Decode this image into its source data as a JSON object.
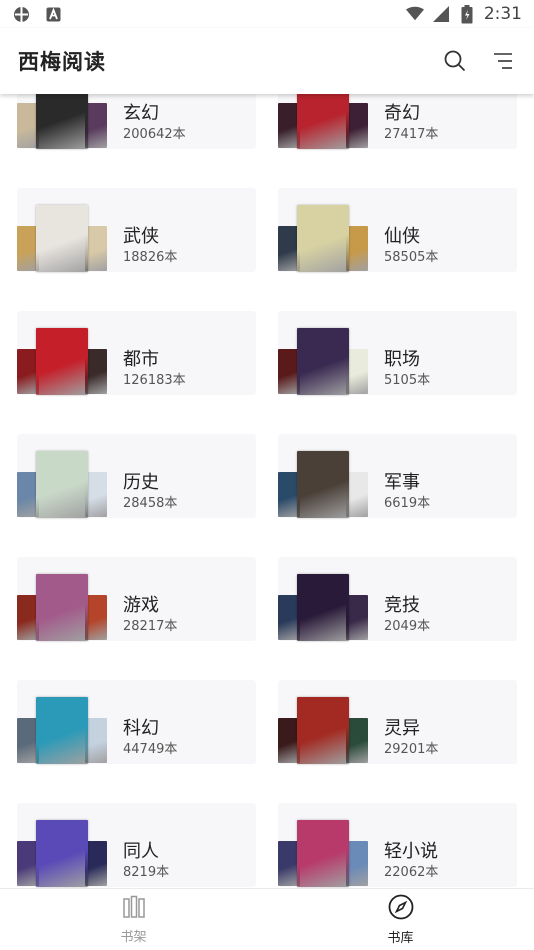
{
  "status": {
    "time": "2:31"
  },
  "app": {
    "title": "西梅阅读"
  },
  "categories": [
    {
      "name": "玄幻",
      "count": "200642本",
      "colors": [
        "#c9b89a",
        "#2a2a2a",
        "#5a3b5e"
      ]
    },
    {
      "name": "奇幻",
      "count": "27417本",
      "colors": [
        "#3a1f2a",
        "#b8232d",
        "#3d2035"
      ]
    },
    {
      "name": "武侠",
      "count": "18826本",
      "colors": [
        "#c9a25a",
        "#e8e4de",
        "#d8c9a8"
      ]
    },
    {
      "name": "仙侠",
      "count": "58505本",
      "colors": [
        "#2f3a4a",
        "#d8d2a2",
        "#c79a4a"
      ]
    },
    {
      "name": "都市",
      "count": "126183本",
      "colors": [
        "#8a1b1e",
        "#c51f2a",
        "#3b2a2a"
      ]
    },
    {
      "name": "职场",
      "count": "5105本",
      "colors": [
        "#5a1a1a",
        "#3a2a52",
        "#e9ecdc"
      ]
    },
    {
      "name": "历史",
      "count": "28458本",
      "colors": [
        "#6a86a8",
        "#c9d9c8",
        "#d5dde6"
      ]
    },
    {
      "name": "军事",
      "count": "6619本",
      "colors": [
        "#2a4a6a",
        "#4a4038",
        "#e8e8e8"
      ]
    },
    {
      "name": "游戏",
      "count": "28217本",
      "colors": [
        "#8a2a1e",
        "#a25a8a",
        "#b4452a"
      ]
    },
    {
      "name": "竞技",
      "count": "2049本",
      "colors": [
        "#2a3a5a",
        "#2a1a3a",
        "#3a2a4a"
      ]
    },
    {
      "name": "科幻",
      "count": "44749本",
      "colors": [
        "#5a6a7a",
        "#2a9ab8",
        "#c4d2e0"
      ]
    },
    {
      "name": "灵异",
      "count": "29201本",
      "colors": [
        "#3a1a1a",
        "#a22a22",
        "#2a4a3a"
      ]
    },
    {
      "name": "同人",
      "count": "8219本",
      "colors": [
        "#4a3a7a",
        "#5a4ab8",
        "#2a2a5a"
      ]
    },
    {
      "name": "轻小说",
      "count": "22062本",
      "colors": [
        "#3a3a6a",
        "#b83a6a",
        "#6a8ab8"
      ]
    }
  ],
  "bottom_nav": [
    {
      "label": "书架"
    },
    {
      "label": "书库"
    }
  ]
}
